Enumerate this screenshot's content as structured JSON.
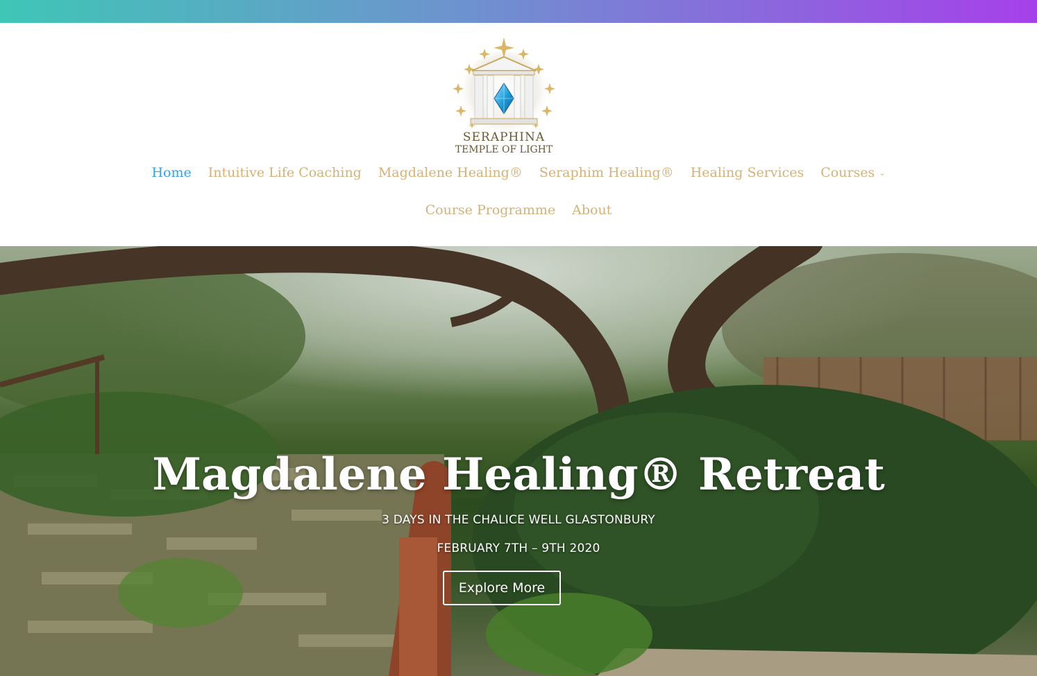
{
  "brand": {
    "logo_line_1": "SERAPHINA",
    "logo_line_2": "TEMPLE OF LIGHT",
    "logo_icon": "temple-diamond-icon"
  },
  "nav": {
    "row1": [
      {
        "label": "Home",
        "active": true
      },
      {
        "label": "Intuitive Life Coaching"
      },
      {
        "label": "Magdalene Healing®"
      },
      {
        "label": "Seraphim Healing®"
      },
      {
        "label": "Healing Services"
      },
      {
        "label": "Courses",
        "has_dropdown": true,
        "dropdown_icon": "chevron-down-icon"
      }
    ],
    "row2": [
      {
        "label": "Course Programme"
      },
      {
        "label": "About"
      }
    ]
  },
  "hero": {
    "title": "Magdalene Healing® Retreat",
    "subtitle_1": "3 DAYS IN THE CHALICE WELL GLASTONBURY",
    "subtitle_2": "FEBRUARY 7TH – 9TH 2020",
    "button_label": "Explore More"
  },
  "colors": {
    "top_bar_gradient": [
      "#3fc6b6",
      "#6e92cf",
      "#a640ea"
    ],
    "nav_text": "#d3b27a",
    "nav_active": "#2ea3f2",
    "hero_text": "#ffffff"
  }
}
